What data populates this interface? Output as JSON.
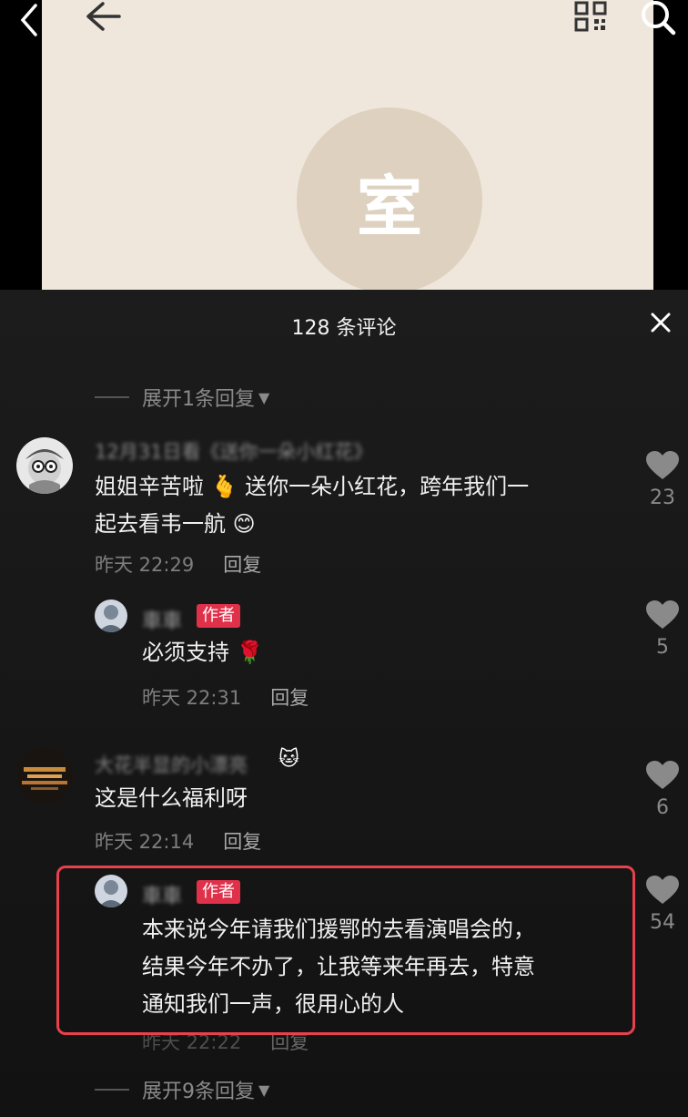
{
  "cover": {
    "avatar_char": "室"
  },
  "sheet": {
    "title": "128 条评论",
    "expand_top": "展开1条回复",
    "expand_bottom": "展开9条回复"
  },
  "comments": [
    {
      "name": "12月31日看《送你一朵小红花》",
      "text_lines": [
        "姐姐辛苦啦",
        "送你一朵小红花，跨年我们一",
        "起去看韦一航"
      ],
      "time": "昨天 22:29",
      "reply": "回复",
      "likes": "23"
    },
    {
      "name": "車車",
      "badge": "作者",
      "text": "必须支持",
      "time": "昨天 22:31",
      "reply": "回复",
      "likes": "5"
    },
    {
      "name": "大花半显的小漂亮",
      "text": "这是什么福利呀",
      "time": "昨天 22:14",
      "reply": "回复",
      "likes": "6"
    },
    {
      "name": "車車",
      "badge": "作者",
      "text_lines": [
        "本来说今年请我们援鄂的去看演唱会的，",
        "结果今年不办了，让我等来年再去，特意",
        "通知我们一声，很用心的人"
      ],
      "time": "昨天 22:22",
      "reply": "回复",
      "likes": "54"
    }
  ],
  "colors": {
    "accent": "#e0314b",
    "highlight": "#e8404c"
  },
  "icons": [
    "back-chevron-icon",
    "back-arrow-icon",
    "qr-code-icon",
    "search-icon",
    "close-icon",
    "heart-icon"
  ]
}
